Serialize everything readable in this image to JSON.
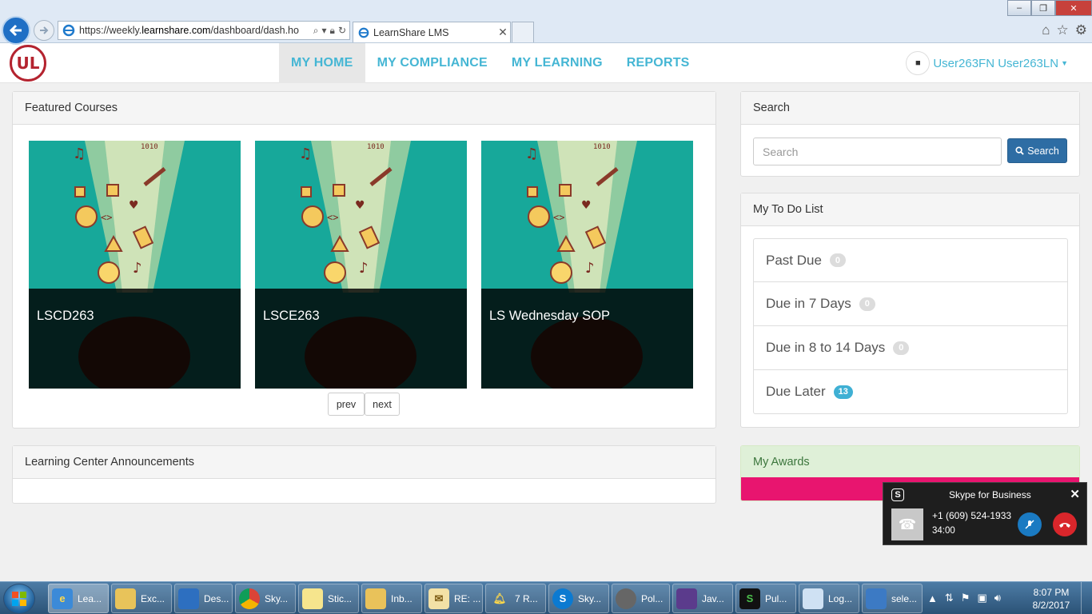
{
  "browser": {
    "url_prefix": "https://weekly.",
    "url_domain": "learnshare.com",
    "url_suffix": "/dashboard/dash.ho",
    "tab_title": "LearnShare LMS"
  },
  "header": {
    "logo_text": "UL",
    "nav": [
      {
        "label": "MY HOME",
        "active": true
      },
      {
        "label": "MY COMPLIANCE"
      },
      {
        "label": "MY LEARNING"
      },
      {
        "label": "REPORTS"
      }
    ],
    "user_name": "User263FN User263LN"
  },
  "featured": {
    "title": "Featured Courses",
    "courses": [
      {
        "title": "LSCD263"
      },
      {
        "title": "LSCE263"
      },
      {
        "title": "LS Wednesday SOP"
      }
    ],
    "prev_label": "prev",
    "next_label": "next"
  },
  "announcements": {
    "title": "Learning Center Announcements"
  },
  "search": {
    "title": "Search",
    "placeholder": "Search",
    "button_label": "Search"
  },
  "todo": {
    "title": "My To Do List",
    "items": [
      {
        "label": "Past Due",
        "count": "0"
      },
      {
        "label": "Due in 7 Days",
        "count": "0"
      },
      {
        "label": "Due in 8 to 14 Days",
        "count": "0"
      },
      {
        "label": "Due Later",
        "count": "13"
      }
    ]
  },
  "awards": {
    "title": "My Awards"
  },
  "skype": {
    "title": "Skype for Business",
    "phone": "+1 (609) 524-1933",
    "timer": "34:00"
  },
  "taskbar": {
    "items": [
      {
        "label": "Lea...",
        "icon": "ie-icon"
      },
      {
        "label": "Exc...",
        "icon": "folder-icon"
      },
      {
        "label": "Des...",
        "icon": "desktop-icon"
      },
      {
        "label": "Sky...",
        "icon": "chrome-icon"
      },
      {
        "label": "Stic...",
        "icon": "sticky-notes-icon"
      },
      {
        "label": "Inb...",
        "icon": "outlook-icon"
      },
      {
        "label": "RE: ...",
        "icon": "mail-icon"
      },
      {
        "label": "7 R...",
        "icon": "reminder-bell-icon"
      },
      {
        "label": "Sky...",
        "icon": "skype-icon"
      },
      {
        "label": "Pol...",
        "icon": "poll-icon"
      },
      {
        "label": "Jav...",
        "icon": "java-ee-icon"
      },
      {
        "label": "Pul...",
        "icon": "pulse-icon"
      },
      {
        "label": "Log...",
        "icon": "notepad-icon"
      },
      {
        "label": "sele...",
        "icon": "remote-desktop-icon"
      }
    ],
    "time": "8:07 PM",
    "date": "8/2/2017"
  }
}
